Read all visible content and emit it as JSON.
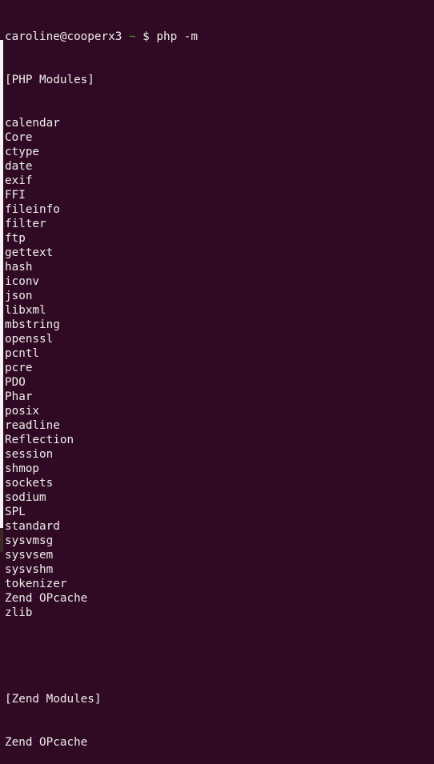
{
  "prompt": {
    "user_host": "caroline@cooperx3",
    "path": "~",
    "symbol": "$",
    "command": "php -m"
  },
  "php_modules_header": "[PHP Modules]",
  "php_modules": [
    "calendar",
    "Core",
    "ctype",
    "date",
    "exif",
    "FFI",
    "fileinfo",
    "filter",
    "ftp",
    "gettext",
    "hash",
    "iconv",
    "json",
    "libxml",
    "mbstring",
    "openssl",
    "pcntl",
    "pcre",
    "PDO",
    "Phar",
    "posix",
    "readline",
    "Reflection",
    "session",
    "shmop",
    "sockets",
    "sodium",
    "SPL",
    "standard",
    "sysvmsg",
    "sysvsem",
    "sysvshm",
    "tokenizer",
    "Zend OPcache",
    "zlib"
  ],
  "zend_modules_header": "[Zend Modules]",
  "zend_modules": [
    "Zend OPcache"
  ],
  "colors": {
    "background": "#300a24",
    "text": "#eeeeec",
    "path": "#4e9a06"
  }
}
